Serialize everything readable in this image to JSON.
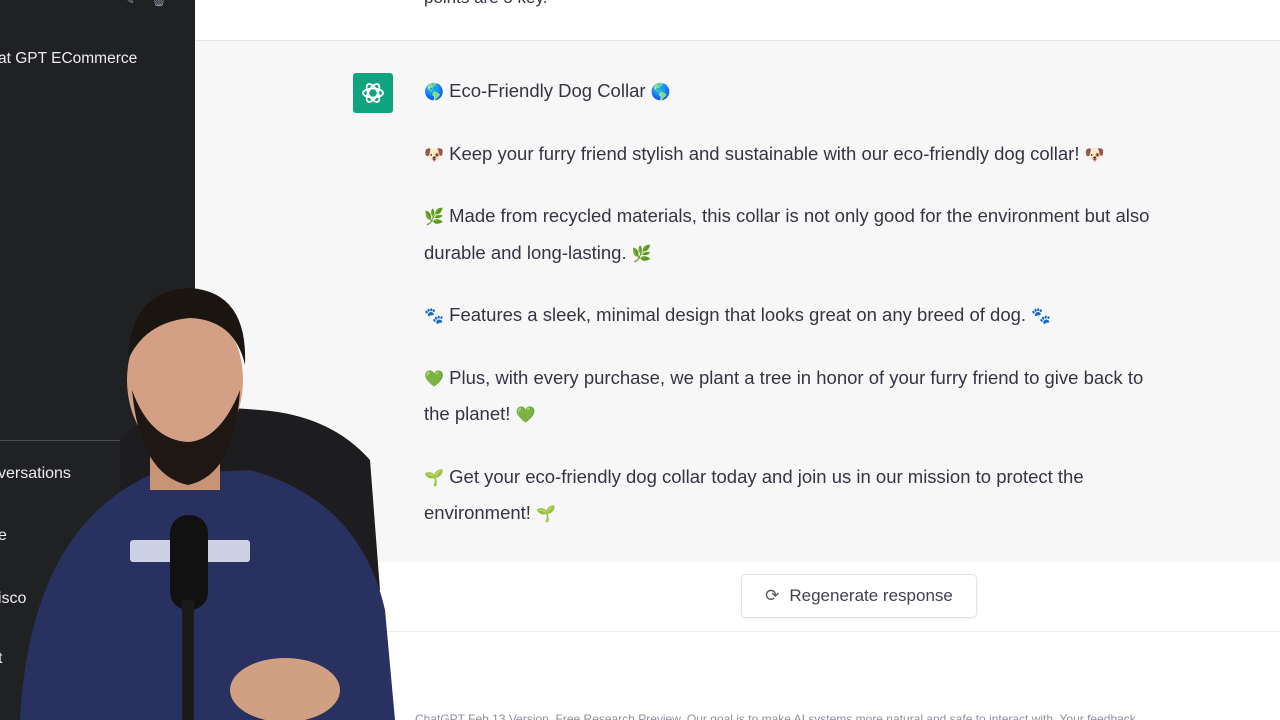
{
  "sidebar": {
    "chat_item_label": "at GPT ECommerce",
    "menu_items": [
      "versations",
      "e",
      "isco",
      "t"
    ]
  },
  "conversation": {
    "previous_message_tail": "points are 5 key.",
    "assistant_lines": [
      {
        "emoji_start": "🌎",
        "text": "Eco-Friendly Dog Collar",
        "emoji_end": "🌎"
      },
      {
        "emoji_start": "🐶",
        "text": "Keep your furry friend stylish and sustainable with our eco-friendly dog collar!",
        "emoji_end": "🐶"
      },
      {
        "emoji_start": "🌿",
        "text_line1": "Made from recycled materials, this collar is not only good for the environment but also",
        "text_line2": "durable and long-lasting.",
        "emoji_end": "🌿"
      },
      {
        "emoji_start": "🐾",
        "text": "Features a sleek, minimal design that looks great on any breed of dog.",
        "emoji_end": "🐾"
      },
      {
        "emoji_start": "💚",
        "text_line1": "Plus, with every purchase, we plant a tree in honor of your furry friend to give back to",
        "text_line2": "the planet!",
        "emoji_end": "💚"
      },
      {
        "emoji_start": "🌱",
        "text_line1": "Get your eco-friendly dog collar today and join us in our mission to protect the",
        "text_line2": "environment!",
        "emoji_end": "🌱"
      }
    ]
  },
  "controls": {
    "regenerate_label": "Regenerate response",
    "regenerate_icon": "refresh-icon"
  },
  "footer": {
    "text": "ChatGPT Feb 13 Version. Free Research Preview. Our goal is to make AI systems more natural and safe to interact with. Your feedback"
  },
  "colors": {
    "sidebar_bg": "#202123",
    "message_bg": "#f7f7f8",
    "brand_green": "#10a37f",
    "text": "#343541"
  }
}
